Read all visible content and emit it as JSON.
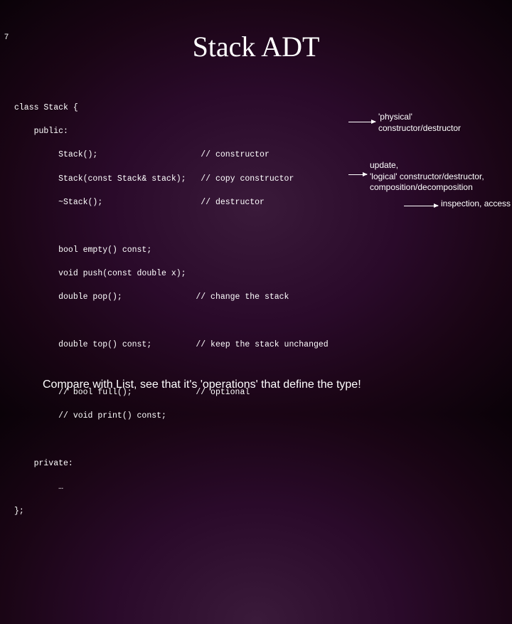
{
  "page_number": "7",
  "title": "Stack ADT",
  "code": {
    "l01": "class Stack {",
    "l02": "    public:",
    "l03": "         Stack();                     // constructor",
    "l04": "         Stack(const Stack& stack);   // copy constructor",
    "l05": "         ~Stack();                    // destructor",
    "l06": "",
    "l07": "         bool empty() const;",
    "l08": "         void push(const double x);",
    "l09": "         double pop();               // change the stack",
    "l10": "",
    "l11": "         double top() const;         // keep the stack unchanged",
    "l12": "",
    "l13": "         // bool full();             // optional",
    "l14": "         // void print() const;",
    "l15": "",
    "l16": "    private:",
    "l17": "         …",
    "l18": "};"
  },
  "annotations": {
    "a1": "'physical' constructor/destructor",
    "a2": "update,\n'logical' constructor/destructor,\ncomposition/decomposition",
    "a3": "inspection, access"
  },
  "footer": "Compare with List, see that it's 'operations' that define the type!"
}
